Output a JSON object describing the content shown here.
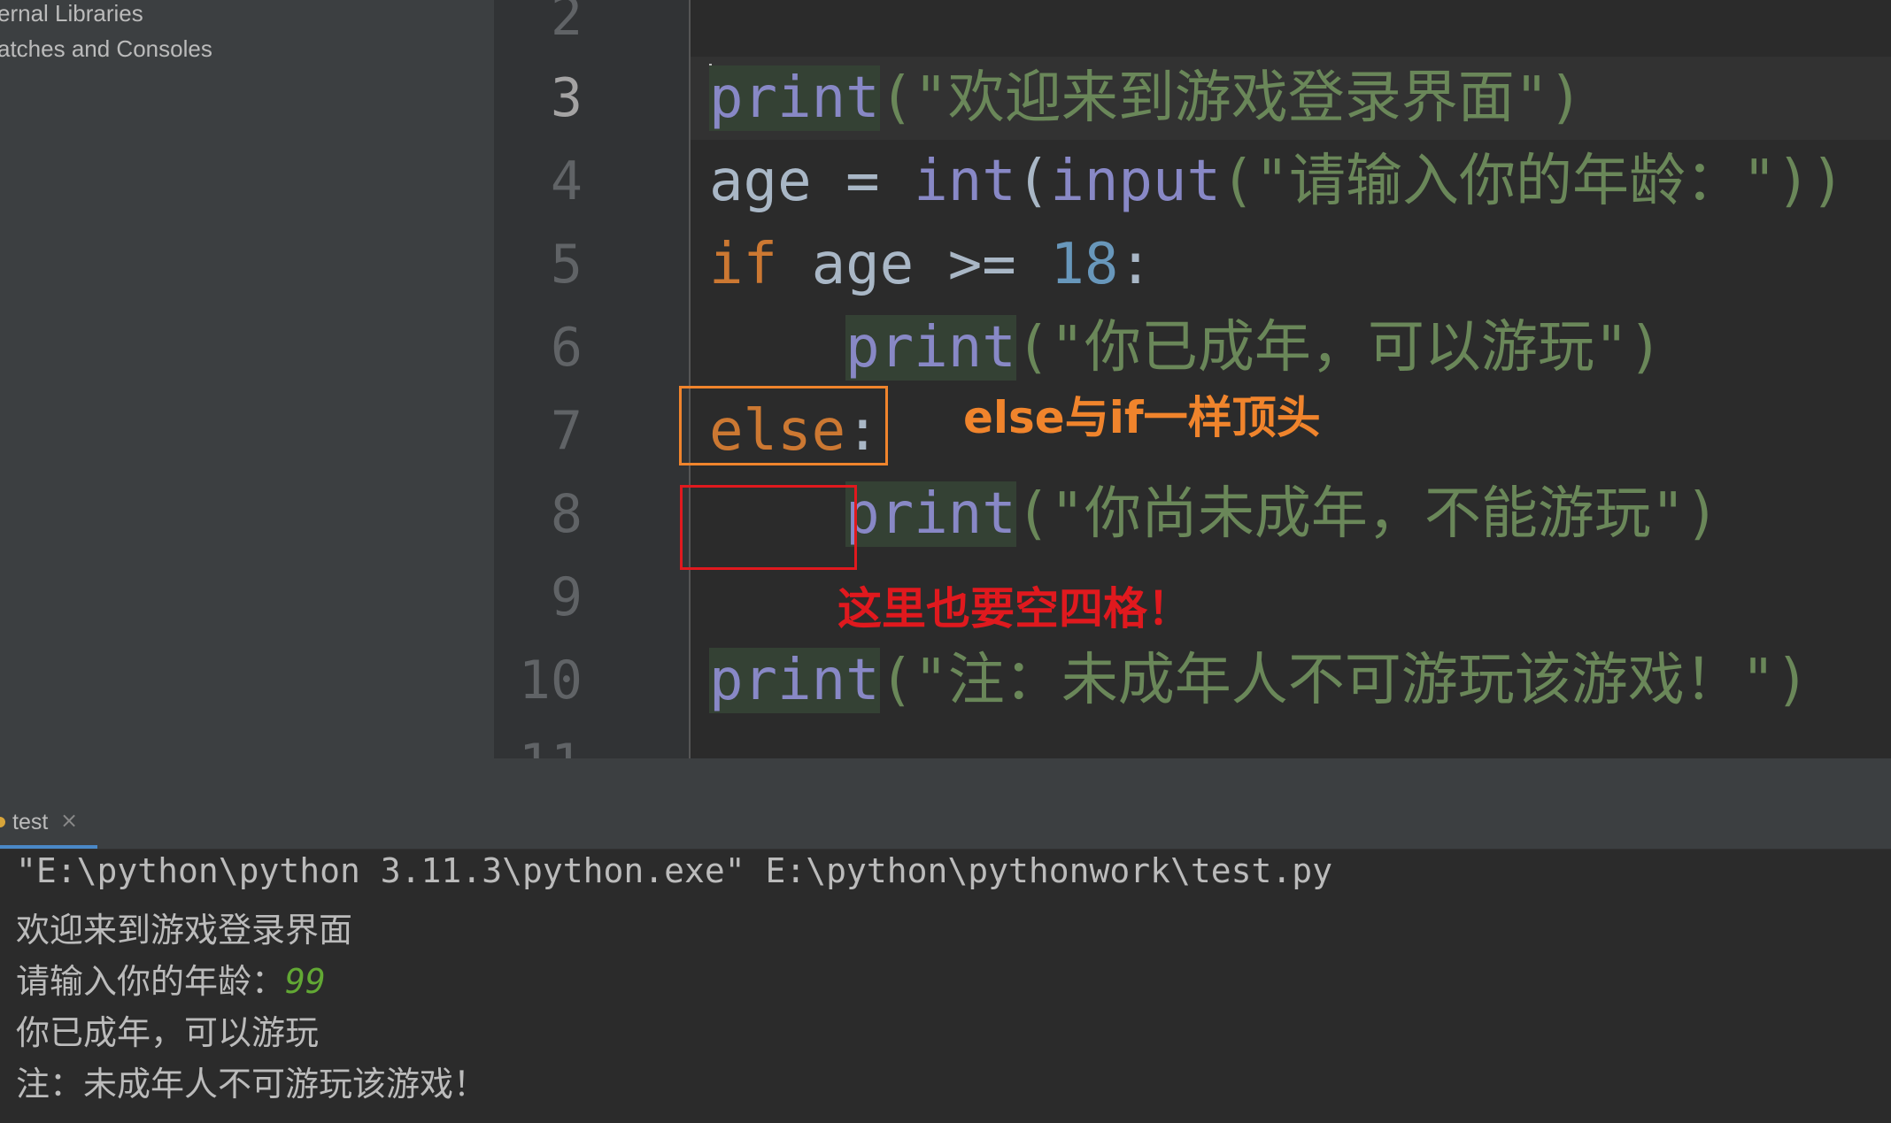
{
  "project_tree": {
    "items": [
      "ernal Libraries",
      "atches and Consoles"
    ]
  },
  "editor": {
    "line_numbers": [
      "2",
      "3",
      "4",
      "5",
      "6",
      "7",
      "8",
      "9",
      "10",
      "11"
    ],
    "active_line": "3",
    "lines": {
      "l3": {
        "fn": "print",
        "rest": "(\"欢迎来到游戏登录界面\")"
      },
      "l4": {
        "var": "age = ",
        "fn1": "int",
        "p1": "(",
        "fn2": "input",
        "str": "(\"请输入你的年龄：\"))"
      },
      "l5": {
        "kw": "if",
        "mid": " age >= ",
        "num": "18",
        "colon": ":"
      },
      "l6": {
        "indent": "    ",
        "fn": "print",
        "str": "(\"你已成年，可以游玩\")"
      },
      "l7": {
        "kw": "else",
        "colon": ":"
      },
      "l8": {
        "indent": "    ",
        "fn": "print",
        "str": "(\"你尚未成年，不能游玩\")"
      },
      "l10": {
        "fn": "print",
        "str": "(\"注：未成年人不可游玩该游戏！\")"
      }
    }
  },
  "annotations": {
    "else_note": "else与if一样顶头",
    "indent_note": "这里也要空四格！",
    "orange": "#f0842c",
    "red": "#e0191e"
  },
  "run_panel": {
    "tab_label": "test",
    "close_glyph": "×"
  },
  "console": {
    "command": "\"E:\\python\\python 3.11.3\\python.exe\" E:\\python\\pythonwork\\test.py",
    "out1": "欢迎来到游戏登录界面",
    "prompt": "请输入你的年龄：",
    "user_input": "99",
    "out2": "你已成年，可以游玩",
    "out3": "注：未成年人不可游玩该游戏！"
  }
}
